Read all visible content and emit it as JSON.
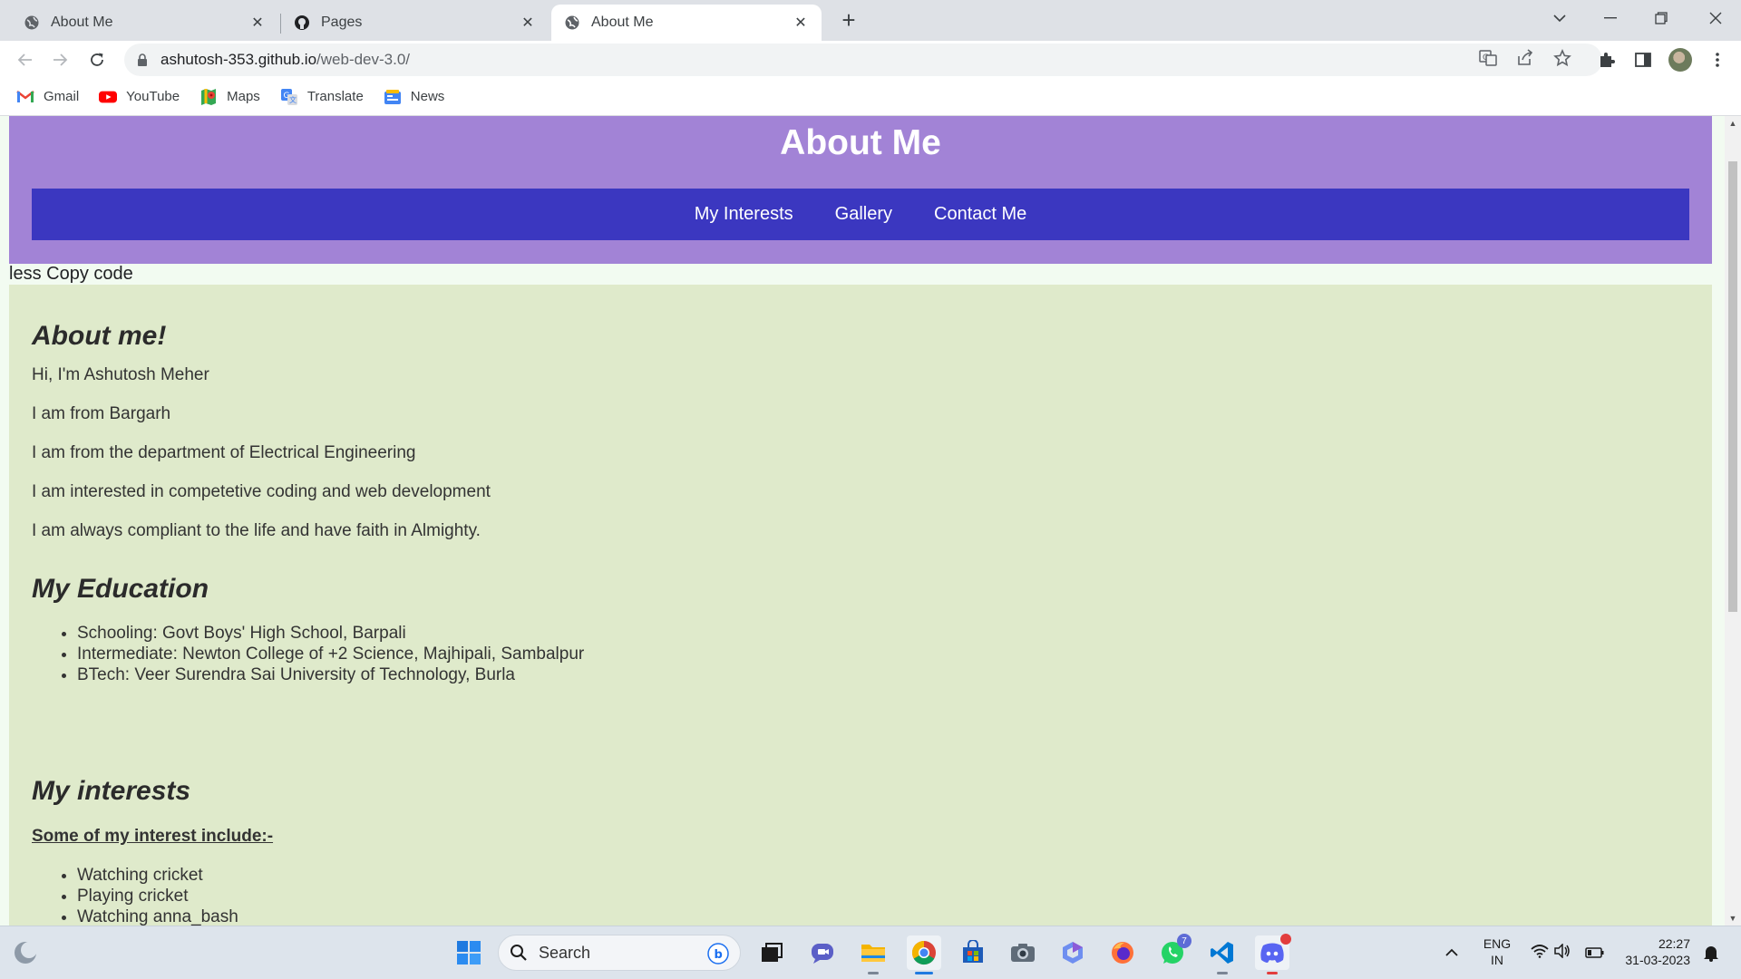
{
  "browser": {
    "tabs": [
      {
        "title": "About Me",
        "favicon": "globe-icon",
        "active": false
      },
      {
        "title": "Pages",
        "favicon": "github-icon",
        "active": false
      },
      {
        "title": "About Me",
        "favicon": "globe-icon",
        "active": true
      }
    ],
    "close_glyph": "✕",
    "new_tab_glyph": "+",
    "window_controls": {
      "list": "⌵",
      "minimize": "—",
      "restore": "❐",
      "close": "✕"
    },
    "address": {
      "host": "ashutosh-353.github.io",
      "path": "/web-dev-3.0/"
    },
    "bookmarks": [
      {
        "label": "Gmail",
        "icon": "gmail-icon"
      },
      {
        "label": "YouTube",
        "icon": "youtube-icon"
      },
      {
        "label": "Maps",
        "icon": "maps-icon"
      },
      {
        "label": "Translate",
        "icon": "translate-icon"
      },
      {
        "label": "News",
        "icon": "news-icon"
      }
    ]
  },
  "page": {
    "header_title": "About Me",
    "nav": [
      "My Interests",
      "Gallery",
      "Contact Me"
    ],
    "stray_text": "less Copy code",
    "about": {
      "heading": "About me!",
      "lines": [
        "Hi, I'm Ashutosh Meher",
        "I am from Bargarh",
        "I am from the department of Electrical Engineering",
        "I am interested in competetive coding and web development",
        "I am always compliant to the life and have faith in Almighty."
      ]
    },
    "education": {
      "heading": "My Education",
      "items": [
        "Schooling: Govt Boys' High School, Barpali",
        "Intermediate: Newton College of +2 Science, Majhipali, Sambalpur",
        "BTech: Veer Surendra Sai University of Technology, Burla"
      ]
    },
    "interests": {
      "heading": "My interests",
      "subheading": "Some of my interest include:-",
      "items": [
        "Watching cricket",
        "Playing cricket",
        "Watching anna_bash"
      ]
    },
    "colors": {
      "header_bg": "#a283d6",
      "nav_bg": "#3b37c0",
      "content_bg": "#dfeacb"
    }
  },
  "taskbar": {
    "search_placeholder": "Search",
    "whatsapp_badge": "7",
    "lang_top": "ENG",
    "lang_bottom": "IN",
    "time": "22:27",
    "date": "31-03-2023"
  }
}
